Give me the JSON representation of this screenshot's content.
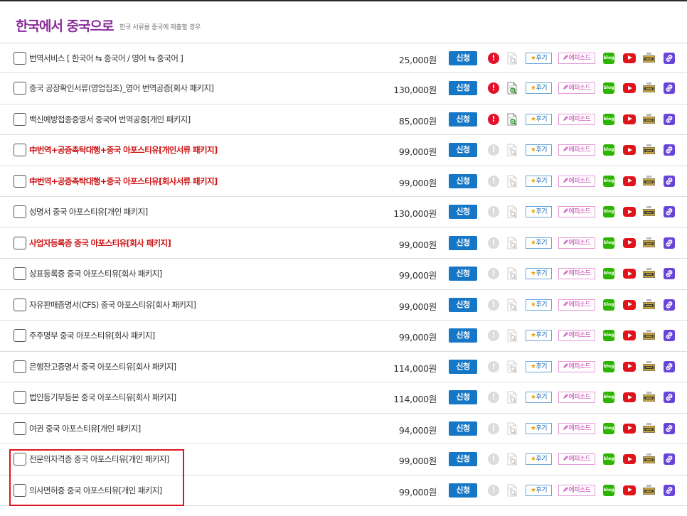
{
  "header": {
    "title": "한국에서 중국으로",
    "subtitle": "한국 서류를 중국에 제출할 경우"
  },
  "buttons": {
    "apply": "신청",
    "review_star": "★",
    "review": "후기",
    "episode": "에피소드",
    "alert_mark": "!",
    "blog": "blog"
  },
  "colors": {
    "title": "#8a2b9a",
    "red_item": "#cc1111",
    "apply_button": "#1577c6",
    "alert_active": "#e2122a",
    "highlight_box": "#e0161d"
  },
  "items": [
    {
      "name": "번역서비스 [ 한국어 ⇆ 중국어 / 영어 ⇆ 중국어 ]",
      "price": "25,000원",
      "red": false,
      "alert_active": true,
      "doc_active": false
    },
    {
      "name": "중국 공장확인서류(영업집조)_영어 번역공증[회사 패키지]",
      "price": "130,000원",
      "red": false,
      "alert_active": true,
      "doc_active": true
    },
    {
      "name": "백신예방접종증명서 중국어 번역공증[개인 패키지]",
      "price": "85,000원",
      "red": false,
      "alert_active": true,
      "doc_active": true
    },
    {
      "name": "中번역+공증촉탁대행+중국 아포스티유[개인서류 패키지]",
      "price": "99,000원",
      "red": true,
      "alert_active": false,
      "doc_active": false
    },
    {
      "name": "中번역+공증촉탁대행+중국 아포스티유[회사서류 패키지]",
      "price": "99,000원",
      "red": true,
      "alert_active": false,
      "doc_active": false
    },
    {
      "name": "성명서 중국 아포스티유[개인 패키지]",
      "price": "130,000원",
      "red": false,
      "alert_active": false,
      "doc_active": false
    },
    {
      "name": "사업자등록증 중국 아포스티유[회사 패키지]",
      "price": "99,000원",
      "red": true,
      "alert_active": false,
      "doc_active": false
    },
    {
      "name": "상표등록증 중국 아포스티유[회사 패키지]",
      "price": "99,000원",
      "red": false,
      "alert_active": false,
      "doc_active": false
    },
    {
      "name": "자유판매증명서(CFS) 중국 아포스티유[회사 패키지]",
      "price": "99,000원",
      "red": false,
      "alert_active": false,
      "doc_active": false
    },
    {
      "name": "주주명부 중국 아포스티유[회사 패키지]",
      "price": "99,000원",
      "red": false,
      "alert_active": false,
      "doc_active": false
    },
    {
      "name": "은행잔고증명서 중국 아포스티유[회사 패키지]",
      "price": "114,000원",
      "red": false,
      "alert_active": false,
      "doc_active": false
    },
    {
      "name": "법인등기부등본 중국 아포스티유[회사 패키지]",
      "price": "114,000원",
      "red": false,
      "alert_active": false,
      "doc_active": false
    },
    {
      "name": "여권 중국 아포스티유[개인 패키지]",
      "price": "94,000원",
      "red": false,
      "alert_active": false,
      "doc_active": false
    },
    {
      "name": "전문의자격증 중국 아포스티유[개인 패키지]",
      "price": "99,000원",
      "red": false,
      "alert_active": false,
      "doc_active": false
    },
    {
      "name": "의사면허증 중국 아포스티유[개인 패키지]",
      "price": "99,000원",
      "red": false,
      "alert_active": false,
      "doc_active": false
    }
  ]
}
